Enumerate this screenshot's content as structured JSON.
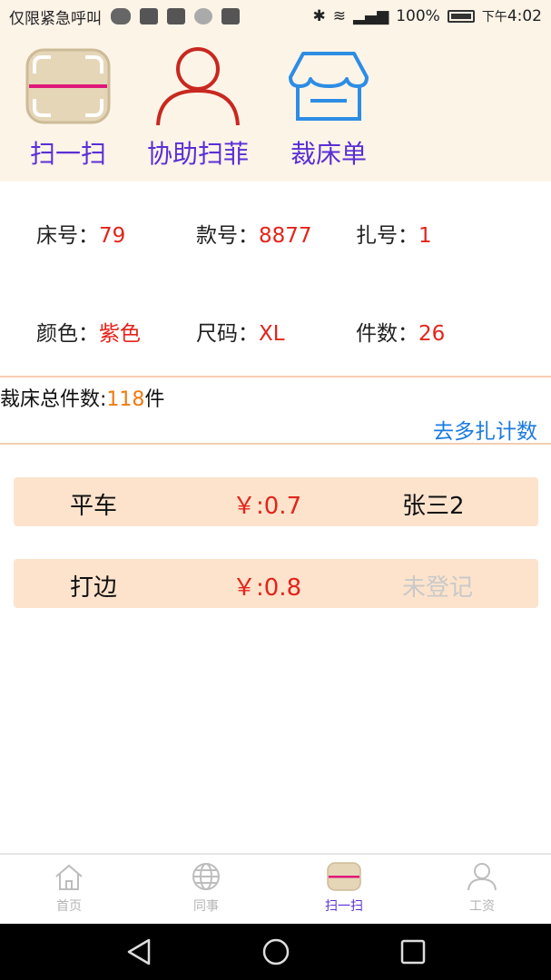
{
  "status_bar": {
    "left_text": "仅限紧急呼叫",
    "battery": "100%",
    "time_prefix": "下午",
    "time": "4:02"
  },
  "actions": [
    {
      "label": "扫一扫",
      "icon": "scan-icon"
    },
    {
      "label": "协助扫菲",
      "icon": "user-icon"
    },
    {
      "label": "裁床单",
      "icon": "store-icon"
    }
  ],
  "info": {
    "bed_no": {
      "label": "床号：",
      "value": "79"
    },
    "style_no": {
      "label": "款号：",
      "value": "8877"
    },
    "bundle_no": {
      "label": "扎号：",
      "value": "1"
    },
    "color": {
      "label": "颜色：",
      "value": "紫色"
    },
    "size": {
      "label": "尺码：",
      "value": "XL"
    },
    "pieces": {
      "label": "件数：",
      "value": "26"
    }
  },
  "total": {
    "label": "裁床总件数:",
    "value": "118",
    "unit": "件"
  },
  "link_multi": "去多扎计数",
  "processes": [
    {
      "name": "平车",
      "price": "￥:0.7",
      "worker": "张三2",
      "registered": true
    },
    {
      "name": "打边",
      "price": "￥:0.8",
      "worker": "未登记",
      "registered": false
    }
  ],
  "nav": [
    {
      "label": "首页",
      "icon": "home-icon",
      "active": false
    },
    {
      "label": "同事",
      "icon": "globe-icon",
      "active": false
    },
    {
      "label": "扫一扫",
      "icon": "scan-icon",
      "active": true
    },
    {
      "label": "工资",
      "icon": "person-icon",
      "active": false
    }
  ],
  "colors": {
    "accent": "#5a2fd4",
    "value_red": "#e3241b",
    "row_bg": "#fde3cc",
    "link": "#1b7be0"
  }
}
